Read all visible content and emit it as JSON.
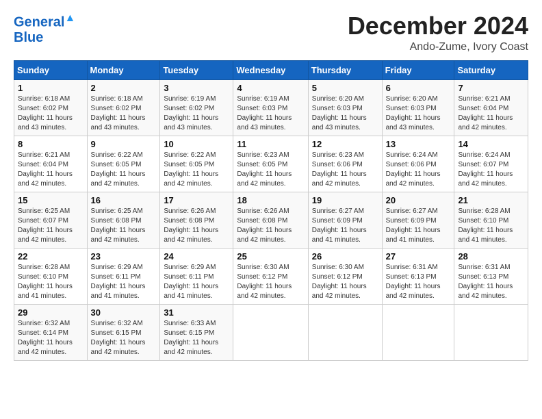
{
  "logo": {
    "line1": "General",
    "line2": "Blue"
  },
  "title": "December 2024",
  "location": "Ando-Zume, Ivory Coast",
  "headers": [
    "Sunday",
    "Monday",
    "Tuesday",
    "Wednesday",
    "Thursday",
    "Friday",
    "Saturday"
  ],
  "weeks": [
    [
      {
        "day": "1",
        "sunrise": "6:18 AM",
        "sunset": "6:02 PM",
        "daylight": "11 hours and 43 minutes."
      },
      {
        "day": "2",
        "sunrise": "6:18 AM",
        "sunset": "6:02 PM",
        "daylight": "11 hours and 43 minutes."
      },
      {
        "day": "3",
        "sunrise": "6:19 AM",
        "sunset": "6:02 PM",
        "daylight": "11 hours and 43 minutes."
      },
      {
        "day": "4",
        "sunrise": "6:19 AM",
        "sunset": "6:03 PM",
        "daylight": "11 hours and 43 minutes."
      },
      {
        "day": "5",
        "sunrise": "6:20 AM",
        "sunset": "6:03 PM",
        "daylight": "11 hours and 43 minutes."
      },
      {
        "day": "6",
        "sunrise": "6:20 AM",
        "sunset": "6:03 PM",
        "daylight": "11 hours and 43 minutes."
      },
      {
        "day": "7",
        "sunrise": "6:21 AM",
        "sunset": "6:04 PM",
        "daylight": "11 hours and 42 minutes."
      }
    ],
    [
      {
        "day": "8",
        "sunrise": "6:21 AM",
        "sunset": "6:04 PM",
        "daylight": "11 hours and 42 minutes."
      },
      {
        "day": "9",
        "sunrise": "6:22 AM",
        "sunset": "6:05 PM",
        "daylight": "11 hours and 42 minutes."
      },
      {
        "day": "10",
        "sunrise": "6:22 AM",
        "sunset": "6:05 PM",
        "daylight": "11 hours and 42 minutes."
      },
      {
        "day": "11",
        "sunrise": "6:23 AM",
        "sunset": "6:05 PM",
        "daylight": "11 hours and 42 minutes."
      },
      {
        "day": "12",
        "sunrise": "6:23 AM",
        "sunset": "6:06 PM",
        "daylight": "11 hours and 42 minutes."
      },
      {
        "day": "13",
        "sunrise": "6:24 AM",
        "sunset": "6:06 PM",
        "daylight": "11 hours and 42 minutes."
      },
      {
        "day": "14",
        "sunrise": "6:24 AM",
        "sunset": "6:07 PM",
        "daylight": "11 hours and 42 minutes."
      }
    ],
    [
      {
        "day": "15",
        "sunrise": "6:25 AM",
        "sunset": "6:07 PM",
        "daylight": "11 hours and 42 minutes."
      },
      {
        "day": "16",
        "sunrise": "6:25 AM",
        "sunset": "6:08 PM",
        "daylight": "11 hours and 42 minutes."
      },
      {
        "day": "17",
        "sunrise": "6:26 AM",
        "sunset": "6:08 PM",
        "daylight": "11 hours and 42 minutes."
      },
      {
        "day": "18",
        "sunrise": "6:26 AM",
        "sunset": "6:08 PM",
        "daylight": "11 hours and 42 minutes."
      },
      {
        "day": "19",
        "sunrise": "6:27 AM",
        "sunset": "6:09 PM",
        "daylight": "11 hours and 41 minutes."
      },
      {
        "day": "20",
        "sunrise": "6:27 AM",
        "sunset": "6:09 PM",
        "daylight": "11 hours and 41 minutes."
      },
      {
        "day": "21",
        "sunrise": "6:28 AM",
        "sunset": "6:10 PM",
        "daylight": "11 hours and 41 minutes."
      }
    ],
    [
      {
        "day": "22",
        "sunrise": "6:28 AM",
        "sunset": "6:10 PM",
        "daylight": "11 hours and 41 minutes."
      },
      {
        "day": "23",
        "sunrise": "6:29 AM",
        "sunset": "6:11 PM",
        "daylight": "11 hours and 41 minutes."
      },
      {
        "day": "24",
        "sunrise": "6:29 AM",
        "sunset": "6:11 PM",
        "daylight": "11 hours and 41 minutes."
      },
      {
        "day": "25",
        "sunrise": "6:30 AM",
        "sunset": "6:12 PM",
        "daylight": "11 hours and 42 minutes."
      },
      {
        "day": "26",
        "sunrise": "6:30 AM",
        "sunset": "6:12 PM",
        "daylight": "11 hours and 42 minutes."
      },
      {
        "day": "27",
        "sunrise": "6:31 AM",
        "sunset": "6:13 PM",
        "daylight": "11 hours and 42 minutes."
      },
      {
        "day": "28",
        "sunrise": "6:31 AM",
        "sunset": "6:13 PM",
        "daylight": "11 hours and 42 minutes."
      }
    ],
    [
      {
        "day": "29",
        "sunrise": "6:32 AM",
        "sunset": "6:14 PM",
        "daylight": "11 hours and 42 minutes."
      },
      {
        "day": "30",
        "sunrise": "6:32 AM",
        "sunset": "6:15 PM",
        "daylight": "11 hours and 42 minutes."
      },
      {
        "day": "31",
        "sunrise": "6:33 AM",
        "sunset": "6:15 PM",
        "daylight": "11 hours and 42 minutes."
      },
      null,
      null,
      null,
      null
    ]
  ]
}
